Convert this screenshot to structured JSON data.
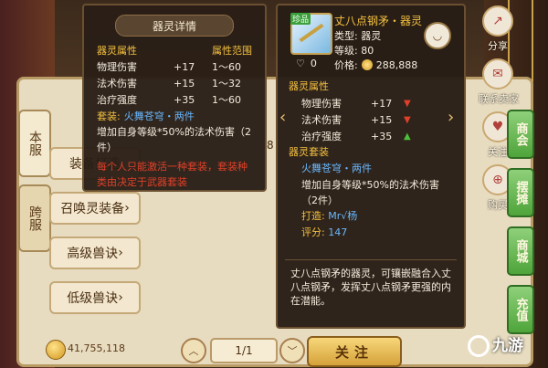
{
  "tooltip": {
    "title": "器灵详情",
    "attr_header": "器灵属性",
    "range_header": "属性范围",
    "attrs": [
      {
        "name": "物理伤害",
        "value": "+17",
        "range": "1～60"
      },
      {
        "name": "法术伤害",
        "value": "+15",
        "range": "1～32"
      },
      {
        "name": "治疗强度",
        "value": "+35",
        "range": "1～60"
      }
    ],
    "suit_label": "套装:",
    "suit_name": "火舞苍穹・两件",
    "suit_effect": "增加自身等级*50%的法术伤害（2件）",
    "warning": "每个人只能激活一种套装，套装种类由决定于武器套装"
  },
  "detail": {
    "badge": "珍品",
    "name": "丈八点钢矛・器灵",
    "type": "类型: 器灵",
    "level": "等级: 80",
    "likes": "0",
    "price_label": "价格:",
    "price": "288,888",
    "attr_section": "器灵属性",
    "attrs": [
      {
        "name": "物理伤害",
        "value": "+17",
        "dir": "down"
      },
      {
        "name": "法术伤害",
        "value": "+15",
        "dir": "down"
      },
      {
        "name": "治疗强度",
        "value": "+35",
        "dir": "up"
      }
    ],
    "suit_section": "器灵套装",
    "suit_name": "火舞苍穹・两件",
    "suit_effect": "增加自身等级*50%的法术伤害（2件）",
    "maker_label": "打造:",
    "maker": "Mr√杨",
    "score_label": "评分:",
    "score": "147",
    "description": "丈八点钢矛的器灵，可镶嵌融合入丈八点钢矛，发挥丈八点钢矛更强的内在潜能。"
  },
  "shop": {
    "left_tabs": [
      "本服",
      "跨服"
    ],
    "categories": [
      {
        "label": "装备打造"
      },
      {
        "label": "召唤灵装备"
      },
      {
        "label": "高级兽诀"
      },
      {
        "label": "低级兽诀"
      }
    ],
    "top_partial_label": "8",
    "coins": "41,755,118",
    "page": "1/1",
    "follow_label": "关注"
  },
  "right_menu": [
    {
      "label": "分享",
      "icon": "share-icon"
    },
    {
      "label": "联系卖家",
      "icon": "contact-seller-icon"
    },
    {
      "label": "关注",
      "icon": "heart-icon"
    },
    {
      "label": "购买",
      "icon": "shopping-bag-icon"
    }
  ],
  "side_tabs": [
    "商会",
    "摆摊",
    "商城",
    "充值"
  ],
  "watermark": "九游"
}
